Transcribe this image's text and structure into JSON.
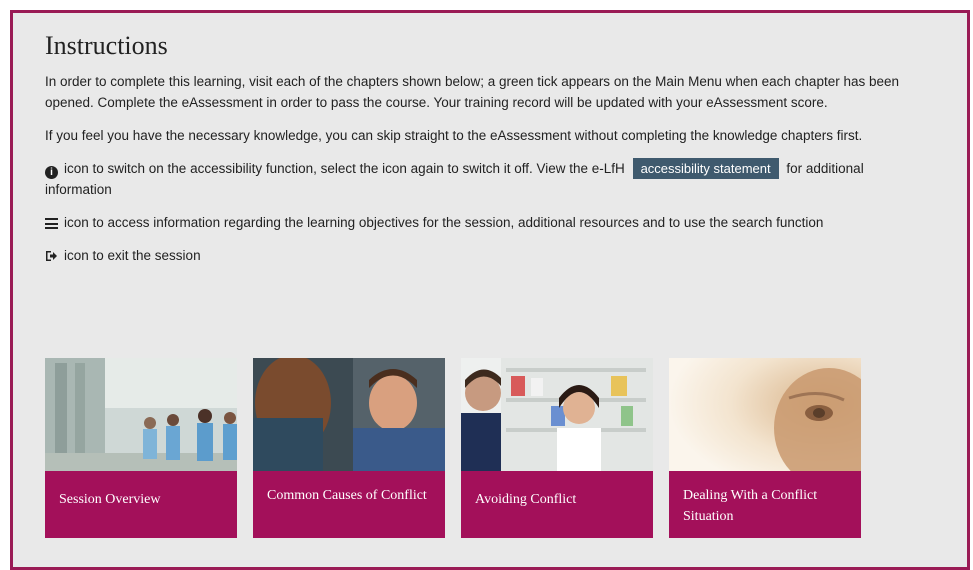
{
  "instructions": {
    "title": "Instructions",
    "para1": "In order to complete this learning, visit each of the chapters shown below; a green tick appears on the Main Menu when each chapter has been opened. Complete the eAssessment in order to pass the course. Your training record will be updated with your eAssessment score.",
    "para2": "If you feel you have the necessary knowledge, you can skip straight to the eAssessment without completing the knowledge chapters first.",
    "accessibility_pre": "icon to switch on the accessibility function, select the icon again to switch it off. View the e-LfH",
    "accessibility_link": "accessibility statement",
    "accessibility_post": "for additional information",
    "menu_text": "icon to access information regarding the learning objectives for the session, additional resources and to use the search function",
    "exit_text": "icon to exit the session"
  },
  "icons": {
    "accessibility": "info-circle-icon",
    "menu": "list-icon",
    "exit": "exit-icon"
  },
  "tiles": [
    {
      "label": "Session Overview",
      "image": "hospital-corridor-staff"
    },
    {
      "label": "Common Causes of Conflict",
      "image": "distressed-man"
    },
    {
      "label": "Avoiding Conflict",
      "image": "pharmacy-conversation"
    },
    {
      "label": "Dealing With a Conflict Situation",
      "image": "elderly-face"
    }
  ],
  "colors": {
    "accent": "#a3105a",
    "frame_border": "#9a1b55",
    "link_bg": "#3f5a6e",
    "background": "#e9e9e9"
  }
}
